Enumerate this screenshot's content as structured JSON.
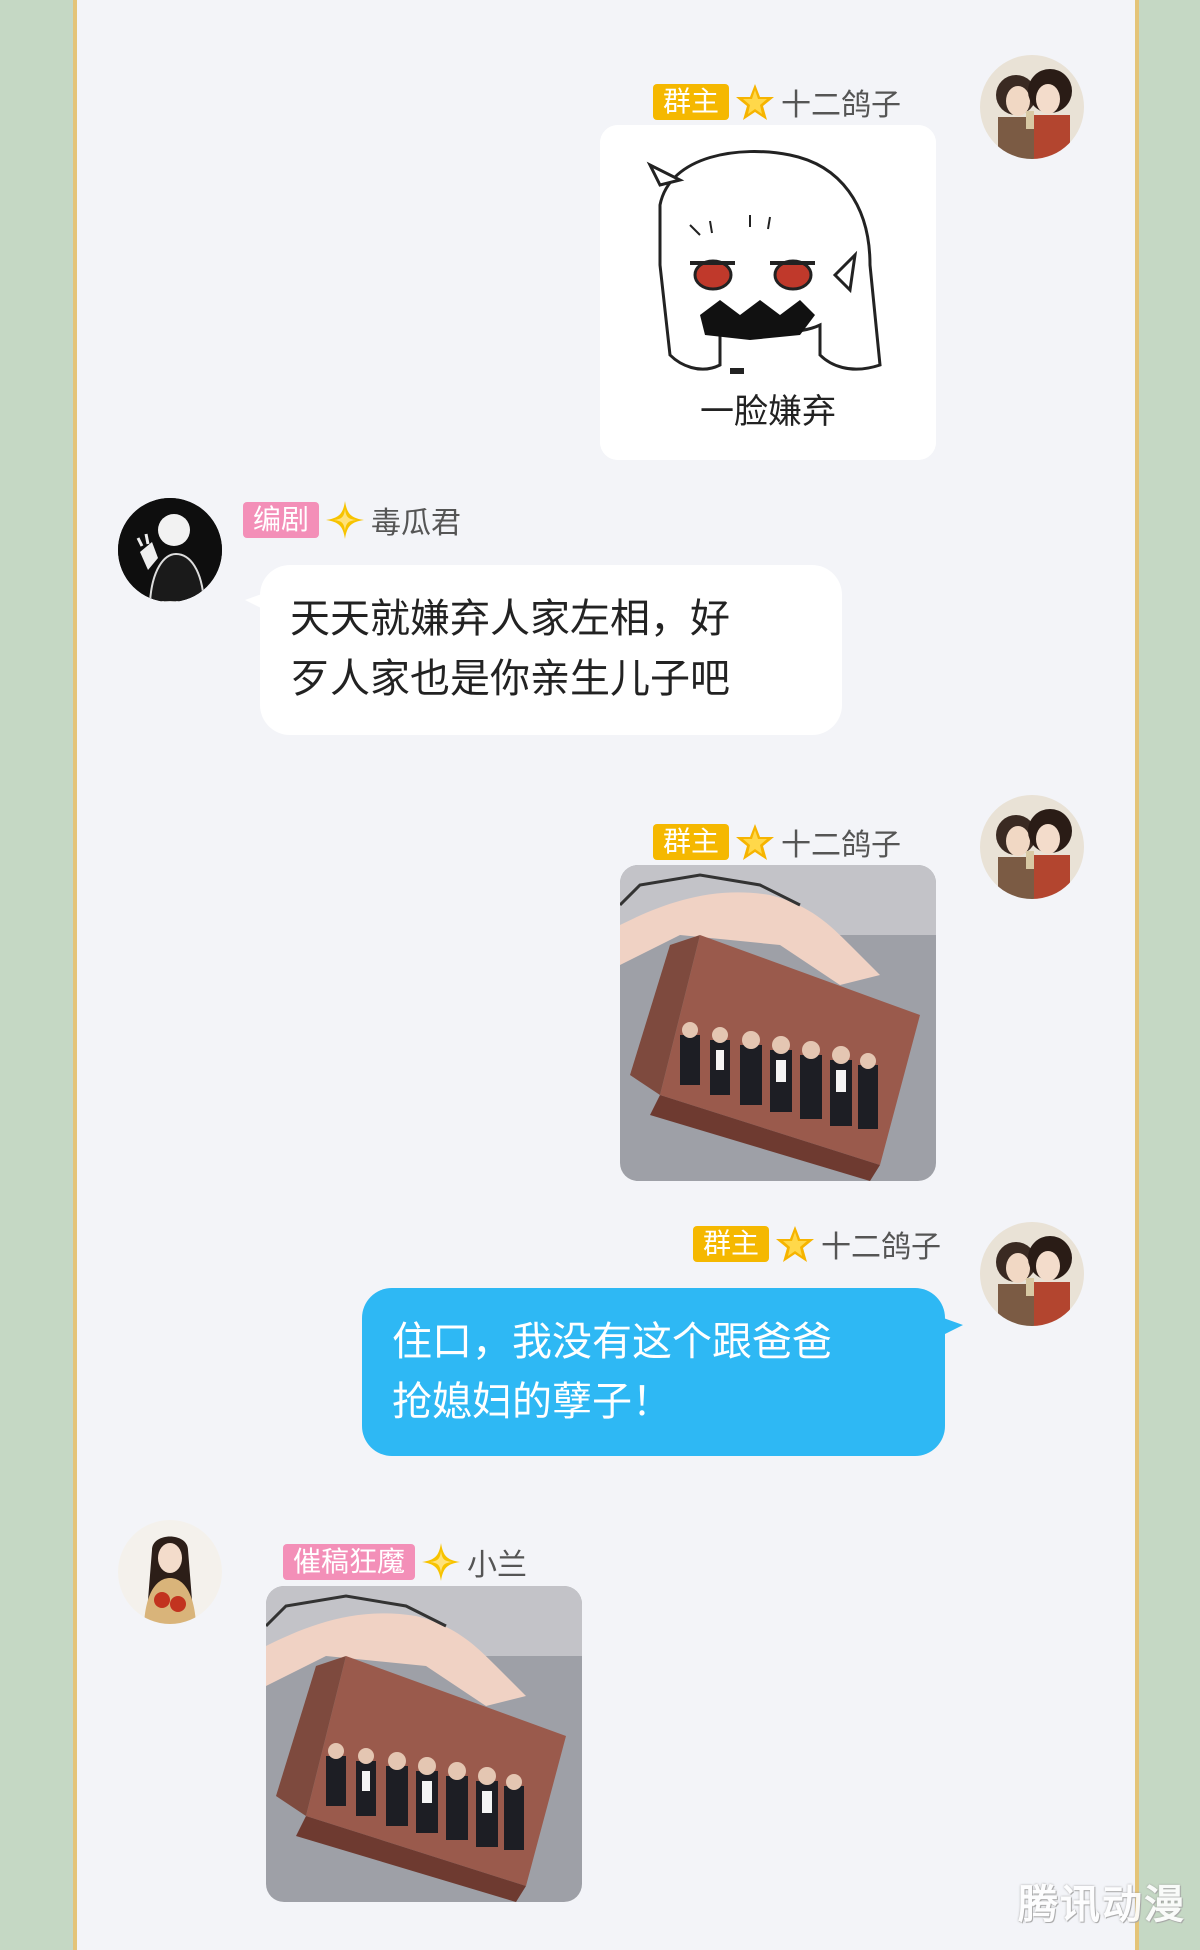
{
  "messages": [
    {
      "role_badge": "群主",
      "name": "十二鸽子",
      "sticker_caption": "一脸嫌弃"
    },
    {
      "role_badge": "编剧",
      "name": "毒瓜君",
      "text_line1": "天天就嫌弃人家左相，好",
      "text_line2": "歹人家也是你亲生儿子吧"
    },
    {
      "role_badge": "群主",
      "name": "十二鸽子"
    },
    {
      "role_badge": "群主",
      "name": "十二鸽子",
      "text_line1": "住口，我没有这个跟爸爸",
      "text_line2": "抢媳妇的孽子！"
    },
    {
      "role_badge": "催稿狂魔",
      "name": "小兰"
    }
  ],
  "watermark": "腾讯动漫",
  "colors": {
    "gold_badge": "#f5b800",
    "pink_badge": "#f38fb8",
    "blue_bubble": "#2eb8f4",
    "frame_border": "#e4c478"
  }
}
